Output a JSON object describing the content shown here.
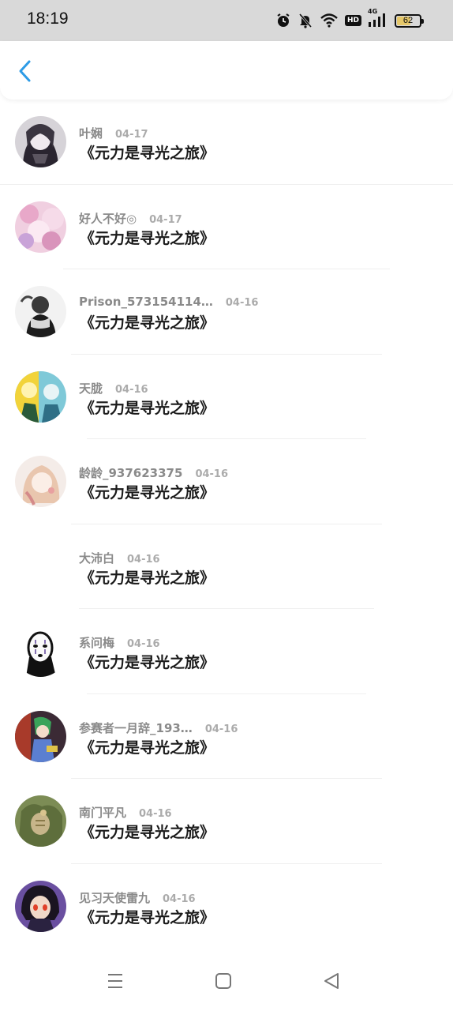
{
  "status_bar": {
    "time": "18:19",
    "hd": "HD",
    "network": "4G",
    "battery_level": "62",
    "icons": [
      "alarm-icon",
      "mute-bell-icon",
      "wifi-icon",
      "hd-icon",
      "signal-4g-icon",
      "battery-icon"
    ]
  },
  "header": {
    "back_icon": "chevron-left-icon",
    "accent_color": "#2d9be6"
  },
  "items": [
    {
      "name": "叶娴",
      "date": "04-17",
      "title": "《元力是寻光之旅》"
    },
    {
      "name": "好人不好◎",
      "date": "04-17",
      "title": "《元力是寻光之旅》"
    },
    {
      "name": "Prison_573154114…",
      "date": "04-16",
      "title": "《元力是寻光之旅》"
    },
    {
      "name": "天胧",
      "date": "04-16",
      "title": "《元力是寻光之旅》"
    },
    {
      "name": "龄龄_937623375",
      "date": "04-16",
      "title": "《元力是寻光之旅》"
    },
    {
      "name": "大沛白",
      "date": "04-16",
      "title": "《元力是寻光之旅》"
    },
    {
      "name": "系问梅",
      "date": "04-16",
      "title": "《元力是寻光之旅》"
    },
    {
      "name": "参赛者一月辞_193…",
      "date": "04-16",
      "title": "《元力是寻光之旅》"
    },
    {
      "name": "南门平凡",
      "date": "04-16",
      "title": "《元力是寻光之旅》"
    },
    {
      "name": "见习天使雷九",
      "date": "04-16",
      "title": "《元力是寻光之旅》"
    }
  ],
  "nav_bar": {
    "icons": [
      "menu-icon",
      "home-square-icon",
      "back-triangle-icon"
    ]
  }
}
